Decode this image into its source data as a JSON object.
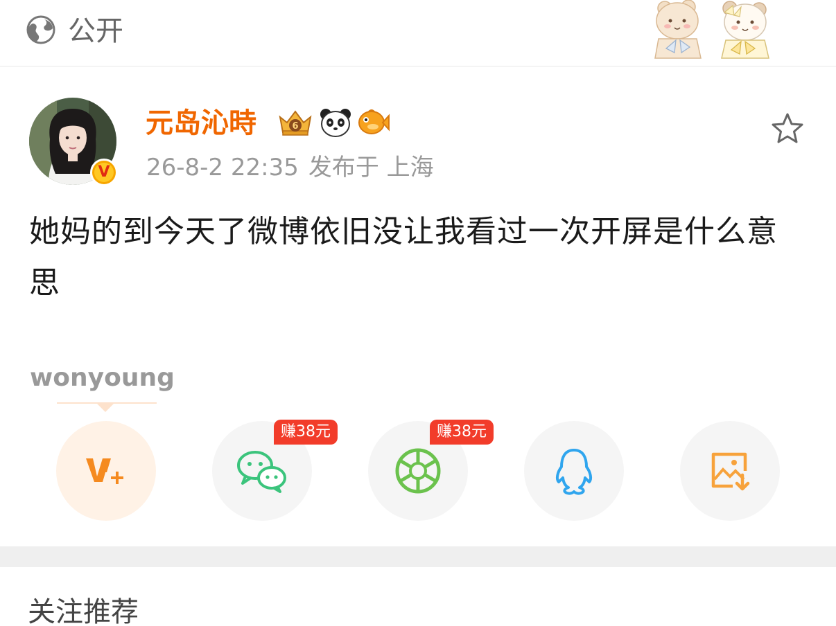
{
  "topbar": {
    "visibility_label": "公开",
    "visibility_icon": "globe-icon",
    "decoration": "bear-sticker-decoration"
  },
  "post": {
    "author": {
      "name": "元岛沁時",
      "name_color": "#f06600",
      "verified_badge": "V",
      "badge_icons": [
        "crown-6-icon",
        "panda-icon",
        "fish-icon"
      ]
    },
    "timestamp": "26-8-2 22:35",
    "location": "发布于 上海",
    "favorite_icon": "star-outline-icon",
    "text": "她妈的到今天了微博依旧没让我看过一次开屏是什么意思",
    "tag": "wonyoung"
  },
  "share": {
    "items": [
      {
        "name": "vplus",
        "icon": "vplus-icon",
        "color": "#f58a1f",
        "selected": true
      },
      {
        "name": "wechat",
        "icon": "wechat-icon",
        "color": "#3bc47c",
        "badge": "赚38元"
      },
      {
        "name": "moments",
        "icon": "moments-icon",
        "color": "#6bc24d",
        "badge": "赚38元"
      },
      {
        "name": "qq",
        "icon": "qq-icon",
        "color": "#2fa5ee"
      },
      {
        "name": "save-image",
        "icon": "save-image-icon",
        "color": "#f7a23b"
      }
    ]
  },
  "recommend": {
    "title": "关注推荐"
  }
}
